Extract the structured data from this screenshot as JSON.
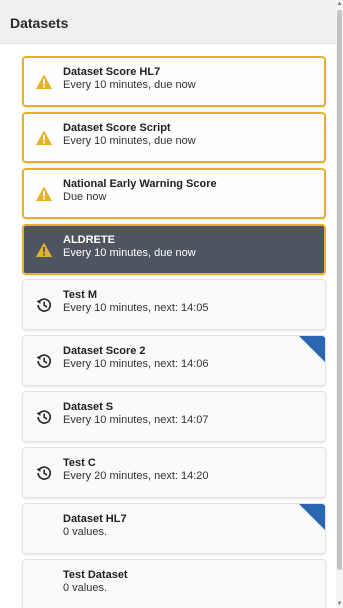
{
  "panel": {
    "title": "Datasets"
  },
  "colors": {
    "warning_border": "#e3b22a",
    "warning_icon": "#e3b22a",
    "selected_background": "#4e5560",
    "corner_flag": "#2a67b3"
  },
  "datasets": [
    {
      "title": "Dataset Score HL7",
      "subtitle": "Every 10 minutes, due now",
      "state": "warning",
      "icon": "warning-icon",
      "flagged": false
    },
    {
      "title": "Dataset Score Script",
      "subtitle": "Every 10 minutes, due now",
      "state": "warning",
      "icon": "warning-icon",
      "flagged": false
    },
    {
      "title": "National Early Warning Score",
      "subtitle": "Due now",
      "state": "warning",
      "icon": "warning-icon",
      "flagged": false
    },
    {
      "title": "ALDRETE",
      "subtitle": "Every 10 minutes, due now",
      "state": "selected",
      "icon": "warning-icon",
      "flagged": false
    },
    {
      "title": "Test M",
      "subtitle": "Every 10 minutes, next: 14:05",
      "state": "scheduled",
      "icon": "history-icon",
      "flagged": false
    },
    {
      "title": "Dataset Score 2",
      "subtitle": "Every 10 minutes, next: 14:06",
      "state": "scheduled",
      "icon": "history-icon",
      "flagged": true
    },
    {
      "title": "Dataset S",
      "subtitle": "Every 10 minutes, next: 14:07",
      "state": "scheduled",
      "icon": "history-icon",
      "flagged": false
    },
    {
      "title": "Test C",
      "subtitle": "Every 20 minutes, next: 14:20",
      "state": "scheduled",
      "icon": "history-icon",
      "flagged": false
    },
    {
      "title": "Dataset HL7",
      "subtitle": "0 values.",
      "state": "plain",
      "icon": "",
      "flagged": true
    },
    {
      "title": "Test Dataset",
      "subtitle": "0 values.",
      "state": "plain",
      "icon": "",
      "flagged": false
    }
  ]
}
